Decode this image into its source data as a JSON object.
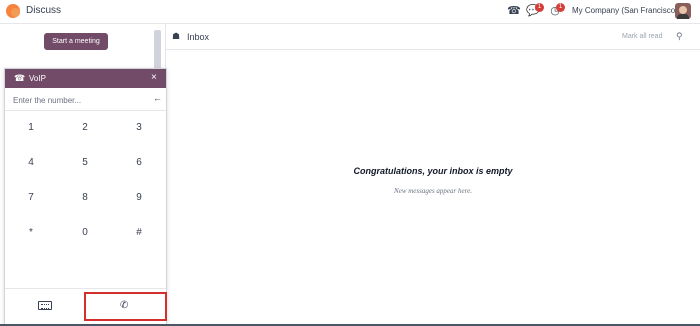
{
  "app": {
    "title": "Discuss"
  },
  "systray": {
    "voip_icon": "phone-icon",
    "messages_badge": "1",
    "activities_badge": "1",
    "company": "My Company (San Francisco)"
  },
  "sidebar": {
    "start_meeting": "Start a meeting"
  },
  "inbox": {
    "title": "Inbox",
    "mark_all_read": "Mark all read",
    "empty_title": "Congratulations, your inbox is empty",
    "empty_subtitle": "New messages appear here."
  },
  "voip": {
    "title": "VoIP",
    "close": "×",
    "input_placeholder": "Enter the number...",
    "backspace": "←",
    "keys": [
      "1",
      "2",
      "3",
      "4",
      "5",
      "6",
      "7",
      "8",
      "9",
      "*",
      "0",
      "#"
    ]
  },
  "colors": {
    "brand": "#714b67",
    "badge": "#d43f3a",
    "highlight": "#d32f2f"
  }
}
